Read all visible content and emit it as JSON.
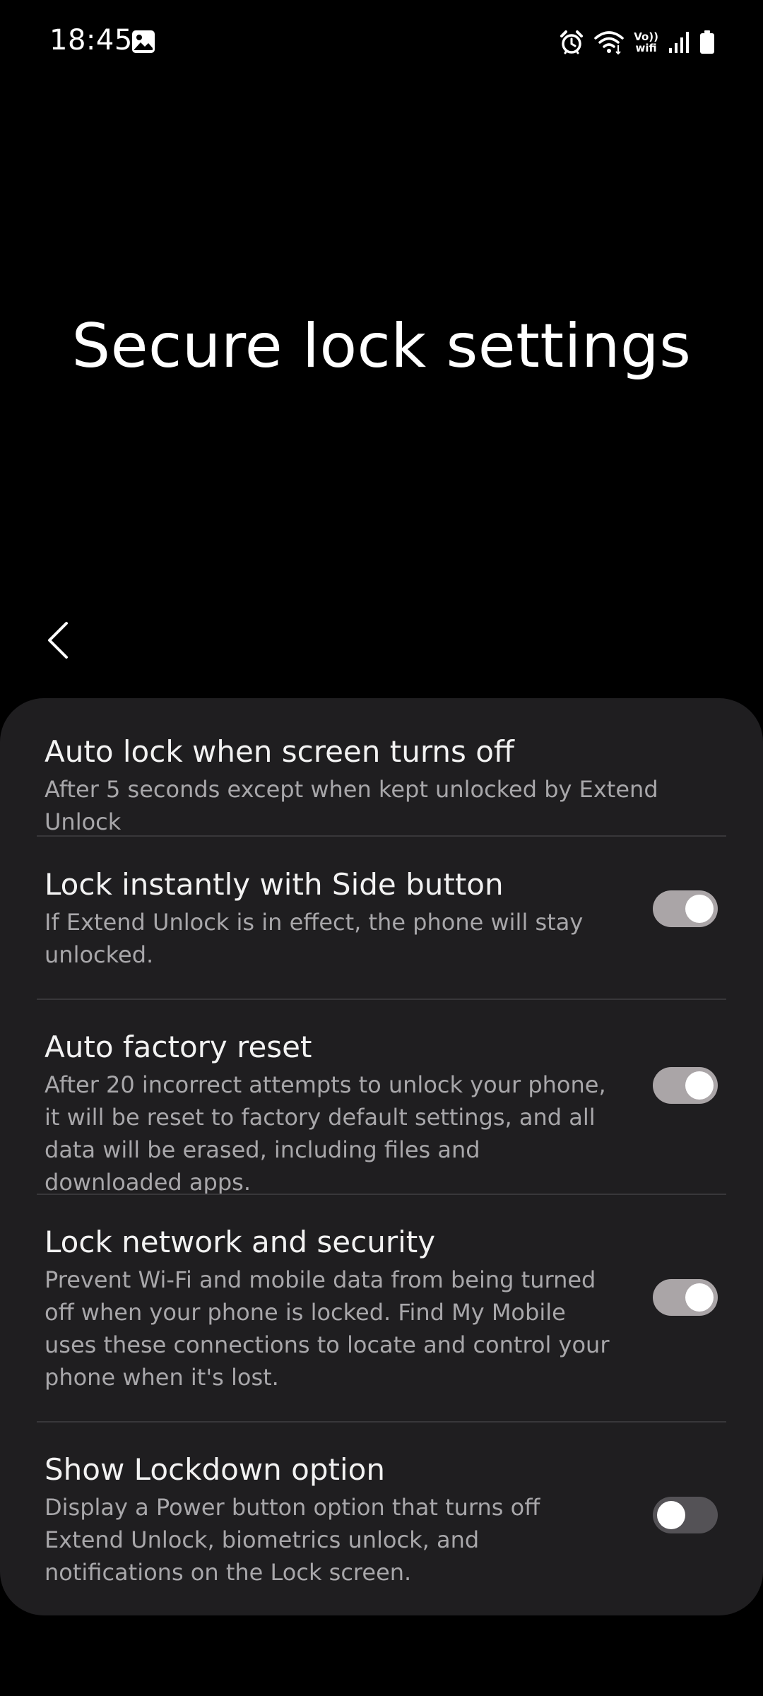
{
  "status_bar": {
    "time": "18:45",
    "volte_line1": "Vo))",
    "volte_line2": "wifi",
    "icons": [
      "gallery-icon",
      "alarm-icon",
      "wifi-icon",
      "volte-wifi-icon",
      "signal-icon",
      "battery-icon"
    ]
  },
  "header": {
    "title": "Secure lock settings",
    "back_icon": "chevron-left-icon"
  },
  "settings": [
    {
      "title": "Auto lock when screen turns off",
      "subtitle": "After 5 seconds except when kept unlocked by Extend Unlock"
    },
    {
      "title": "Lock instantly with Side button",
      "subtitle": "If Extend Unlock is in effect, the phone will stay unlocked.",
      "toggle": true
    },
    {
      "title": "Auto factory reset",
      "subtitle": "After 20 incorrect attempts to unlock your phone, it will be reset to factory default settings, and all data will be erased, including files and downloaded apps.",
      "toggle": true
    },
    {
      "title": "Lock network and security",
      "subtitle": "Prevent Wi-Fi and mobile data from being turned off when your phone is locked. Find My Mobile uses these connections to locate and control your phone when it's lost.",
      "toggle": true
    },
    {
      "title": "Show Lockdown option",
      "subtitle": "Display a Power button option that turns off Extend Unlock, biometrics unlock, and notifications on the Lock screen.",
      "toggle": false
    }
  ],
  "colors": {
    "background": "#000000",
    "card": "#1f1e20",
    "toggle_on": "#aaa5a7",
    "toggle_off": "#545256",
    "subtitle": "#a8a7aa"
  }
}
